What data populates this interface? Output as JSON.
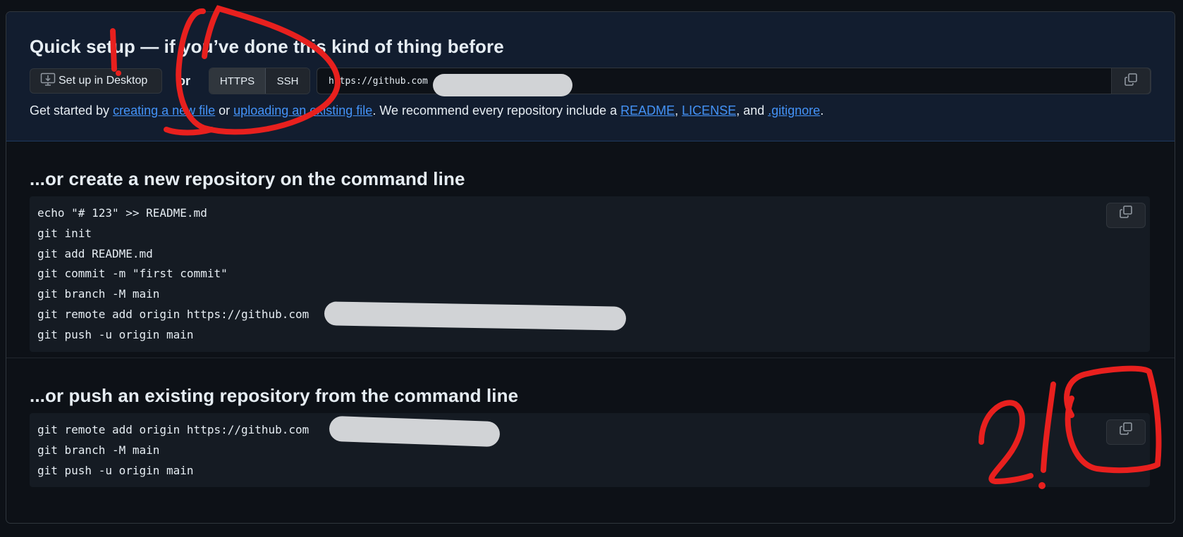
{
  "quick_setup": {
    "title": "Quick setup — if you’ve done this kind of thing before",
    "desktop_button": "Set up in Desktop",
    "or_label": "or",
    "protocols": [
      "HTTPS",
      "SSH"
    ],
    "url_value": "https://github.com",
    "get_started": {
      "prefix": "Get started by ",
      "link1": "creating a new file",
      "mid1": " or ",
      "link2": "uploading an existing file",
      "mid2": ". We recommend every repository include a ",
      "link3": "README",
      "sep1": ", ",
      "link4": "LICENSE",
      "sep2": ", and ",
      "link5": ".gitignore",
      "suffix": "."
    }
  },
  "new_repo": {
    "title": "...or create a new repository on the command line",
    "lines": [
      "echo \"# 123\" >> README.md",
      "git init",
      "git add README.md",
      "git commit -m \"first commit\"",
      "git branch -M main",
      "git remote add origin https://github.com",
      "git push -u origin main"
    ]
  },
  "push_existing": {
    "title": "...or push an existing repository from the command line",
    "lines": [
      "git remote add origin https://github.com",
      "git branch -M main",
      "git push -u origin main"
    ]
  },
  "annotations": [
    "1.",
    "2."
  ],
  "colors": {
    "link": "#4493f8",
    "annotation": "#e8201e",
    "redaction": "#d1d3d6"
  }
}
